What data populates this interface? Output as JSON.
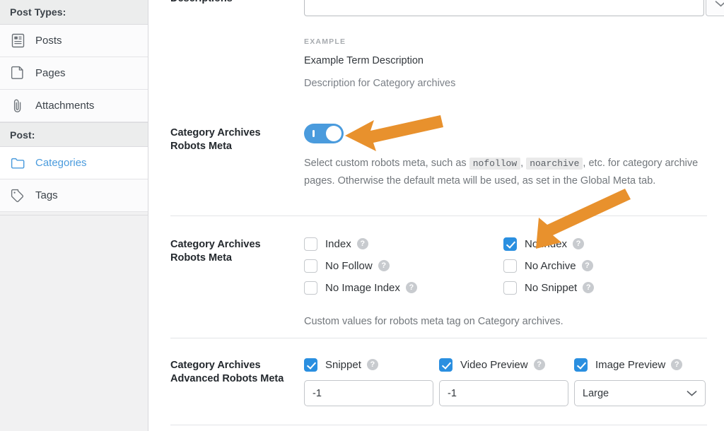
{
  "sidebar": {
    "sections": [
      {
        "title": "Post Types:"
      },
      {
        "title": "Post:"
      }
    ],
    "post_types_header": "Post Types:",
    "post_header": "Post:",
    "items": [
      {
        "label": "Posts",
        "icon": "posts-icon",
        "active": false
      },
      {
        "label": "Pages",
        "icon": "pages-icon",
        "active": false
      },
      {
        "label": "Attachments",
        "icon": "attachments-icon",
        "active": false
      }
    ],
    "post_items": [
      {
        "label": "Categories",
        "icon": "folder-icon",
        "active": true
      },
      {
        "label": "Tags",
        "icon": "tag-icon",
        "active": false
      }
    ]
  },
  "main": {
    "descriptions_label": "Descriptions",
    "description_textarea_value": "",
    "description_dropdown_icon": "chevron-down-icon",
    "example_label": "EXAMPLE",
    "example_value": "Example Term Description",
    "example_caption": "Description for Category archives",
    "robots_toggle_row": {
      "label_line1": "Category Archives",
      "label_line2": "Robots Meta",
      "toggle_state": "on",
      "help_prefix": "Select custom robots meta, such as ",
      "help_code_1": "nofollow",
      "help_mid": ", ",
      "help_code_2": "noarchive",
      "help_suffix": ", etc. for category archive pages. Otherwise the default meta will be used, as set in the Global Meta tab."
    },
    "robots_checks_row": {
      "label_line1": "Category Archives",
      "label_line2": "Robots Meta",
      "left_column": [
        {
          "label": "Index",
          "checked": false
        },
        {
          "label": "No Follow",
          "checked": false
        },
        {
          "label": "No Image Index",
          "checked": false
        }
      ],
      "right_column": [
        {
          "label": "No Index",
          "checked": true
        },
        {
          "label": "No Archive",
          "checked": false
        },
        {
          "label": "No Snippet",
          "checked": false
        }
      ],
      "note": "Custom values for robots meta tag on Category archives."
    },
    "advanced_row": {
      "label_line1": "Category Archives",
      "label_line2": "Advanced Robots Meta",
      "fields": [
        {
          "label": "Snippet",
          "checked": true,
          "type": "text",
          "value": "-1"
        },
        {
          "label": "Video Preview",
          "checked": true,
          "type": "text",
          "value": "-1"
        },
        {
          "label": "Image Preview",
          "checked": true,
          "type": "select",
          "value": "Large"
        }
      ]
    }
  },
  "annotations": {
    "arrow_color": "#e8912d",
    "arrow_1_target": "robots-meta-toggle",
    "arrow_2_target": "no-index-checkbox"
  },
  "colors": {
    "accent_blue": "#2a8fe0",
    "toggle_blue": "#4a9bdd",
    "link_blue": "#4a9bdd",
    "sidebar_bg": "#f1f1f2",
    "text_dark": "#23282d",
    "text_muted": "#72777c"
  }
}
